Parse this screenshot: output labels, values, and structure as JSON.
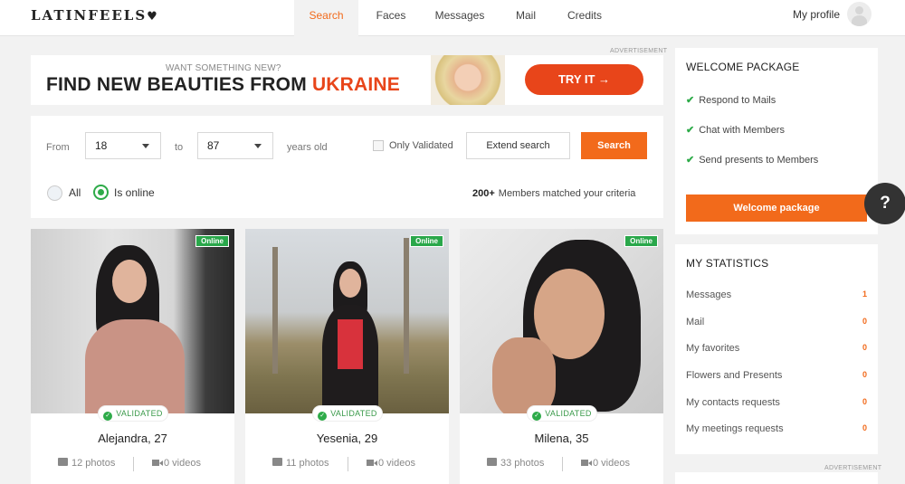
{
  "brand": {
    "logo": "LATINFEELS",
    "logo_mark": "♥"
  },
  "nav": {
    "items": [
      "Search",
      "Faces",
      "Messages",
      "Mail",
      "Credits"
    ],
    "active": "Search",
    "profile_label": "My profile"
  },
  "ad": {
    "tag": "ADVERTISEMENT",
    "small_text": "WANT SOMETHING NEW?",
    "headline_prefix": "FIND NEW BEAUTIES FROM ",
    "headline_accent": "UKRAINE",
    "cta": "TRY IT →"
  },
  "filter": {
    "from_label": "From",
    "from_value": "18",
    "to_label": "to",
    "to_value": "87",
    "years_label": "years old",
    "only_validated_label": "Only Validated",
    "only_validated_checked": false,
    "extend_label": "Extend search",
    "search_label": "Search",
    "radio_all": "All",
    "radio_online": "Is online",
    "radio_selected": "Is online",
    "matched_count": "200+",
    "matched_text": "Members matched your criteria"
  },
  "profiles": [
    {
      "name": "Alejandra, 27",
      "online_label": "Online",
      "validated_label": "VALIDATED",
      "photos": "12 photos",
      "videos": "0 videos"
    },
    {
      "name": "Yesenia, 29",
      "online_label": "Online",
      "validated_label": "VALIDATED",
      "photos": "11 photos",
      "videos": "0 videos"
    },
    {
      "name": "Milena, 35",
      "online_label": "Online",
      "validated_label": "VALIDATED",
      "photos": "33 photos",
      "videos": "0 videos"
    }
  ],
  "welcome": {
    "title": "WELCOME PACKAGE",
    "items": [
      "Respond to Mails",
      "Chat with Members",
      "Send presents to Members"
    ],
    "button": "Welcome package"
  },
  "stats": {
    "title": "MY STATISTICS",
    "rows": [
      {
        "label": "Messages",
        "value": "1"
      },
      {
        "label": "Mail",
        "value": "0"
      },
      {
        "label": "My favorites",
        "value": "0"
      },
      {
        "label": "Flowers and Presents",
        "value": "0"
      },
      {
        "label": "My contacts requests",
        "value": "0"
      },
      {
        "label": "My meetings requests",
        "value": "0"
      }
    ]
  },
  "help": {
    "label": "?"
  },
  "colors": {
    "accent": "#f26a1b",
    "ad_red": "#e8451a",
    "online_green": "#29a74a"
  }
}
